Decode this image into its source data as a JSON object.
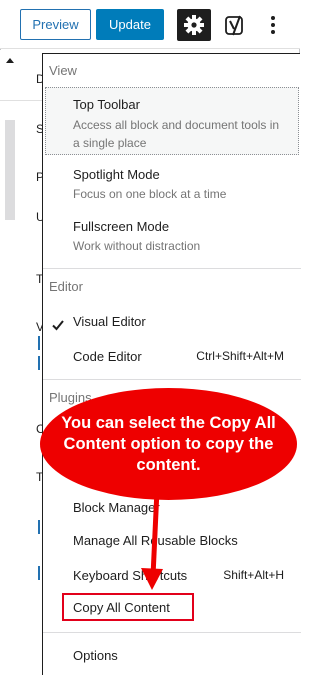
{
  "toolbar": {
    "preview_label": "Preview",
    "update_label": "Update"
  },
  "background_panel": {
    "letters": [
      "D",
      "S",
      "P",
      "U",
      "T",
      "V",
      "C",
      "T"
    ]
  },
  "menu": {
    "view_heading": "View",
    "view_items": [
      {
        "title": "Top Toolbar",
        "description": "Access all block and document tools in a single place"
      },
      {
        "title": "Spotlight Mode",
        "description": "Focus on one block at a time"
      },
      {
        "title": "Fullscreen Mode",
        "description": "Work without distraction"
      }
    ],
    "editor_heading": "Editor",
    "editor_items": [
      {
        "title": "Visual Editor"
      },
      {
        "title": "Code Editor",
        "shortcut": "Ctrl+Shift+Alt+M"
      }
    ],
    "plugins_heading": "Plugins",
    "tools_items": [
      {
        "title": "Block Manager"
      },
      {
        "title": "Manage All Reusable Blocks"
      },
      {
        "title": "Keyboard Shortcuts",
        "shortcut": "Shift+Alt+H"
      },
      {
        "title": "Copy All Content"
      }
    ],
    "options_label": "Options"
  },
  "callout": {
    "text": "You can select the Copy All Content option to copy the content."
  },
  "colors": {
    "accent": "#007cba",
    "callout": "#ee0000",
    "highlight": "#e2001a"
  }
}
